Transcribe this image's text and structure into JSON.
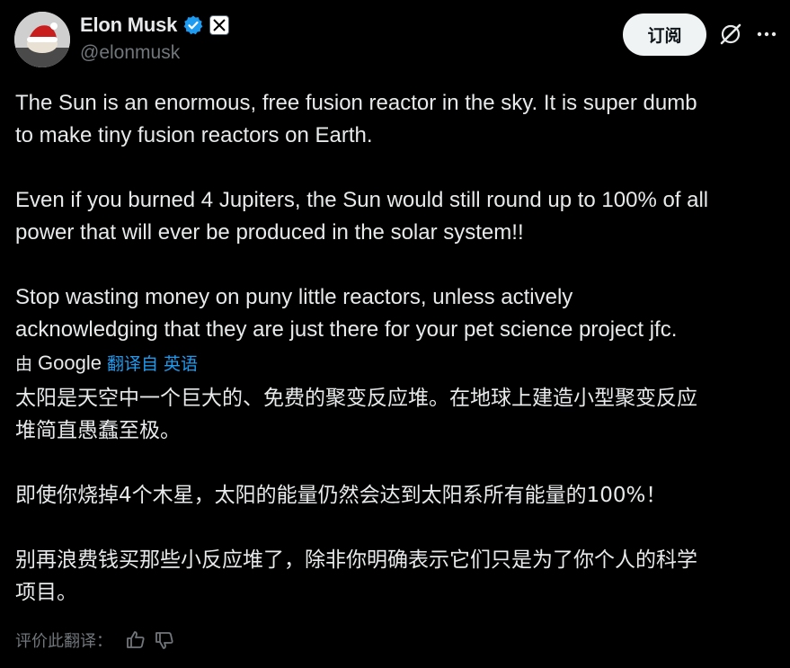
{
  "author": {
    "display_name": "Elon Musk",
    "handle": "@elonmusk",
    "avatar_icon": "santa-hat-avatar-icon",
    "verified_icon": "verified-badge-icon",
    "affiliate_icon": "x-logo-icon"
  },
  "header": {
    "subscribe_label": "订阅",
    "grok_icon": "grok-icon",
    "more_icon": "more-options-icon"
  },
  "tweet": {
    "text": "The Sun is an enormous, free fusion reactor in the sky. It is super dumb\nto make tiny fusion reactors on Earth.\n\nEven if you burned 4 Jupiters, the Sun would still round up to 100% of all\npower that will ever be produced in the solar system!!\n\nStop wasting money on puny little reactors, unless actively\nacknowledging that they are just there for your pet science project jfc."
  },
  "translation": {
    "by_label": "由",
    "provider": "Google",
    "from_label": "翻译自 英语",
    "text": "太阳是天空中一个巨大的、免费的聚变反应堆。在地球上建造小型聚变反应\n堆简直愚蠢至极。\n\n即使你烧掉4个木星，太阳的能量仍然会达到太阳系所有能量的100%！\n\n别再浪费钱买那些小反应堆了，除非你明确表示它们只是为了你个人的科学\n项目。",
    "rate_label": "评价此翻译：",
    "thumbs_up_icon": "thumbs-up-icon",
    "thumbs_down_icon": "thumbs-down-icon"
  },
  "colors": {
    "background": "#000000",
    "text": "#e7e9ea",
    "secondary": "#71767b",
    "link": "#1d9bf0",
    "verified": "#1d9bf0"
  }
}
